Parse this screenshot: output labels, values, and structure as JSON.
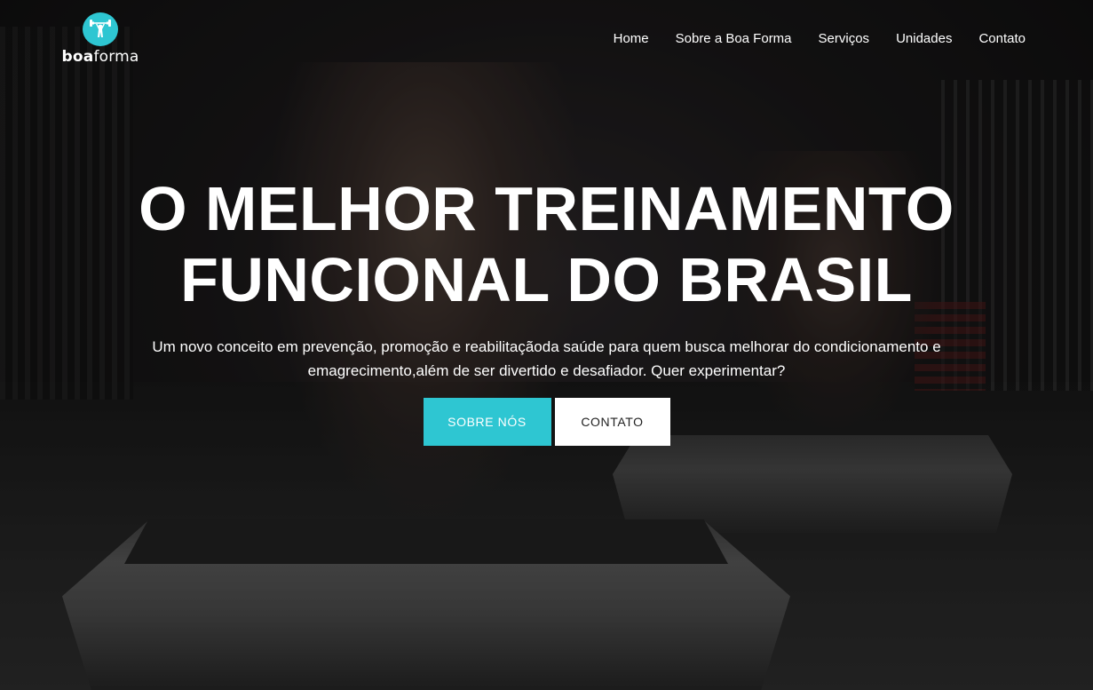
{
  "brand": {
    "name_bold": "boa",
    "name_light": "forma",
    "accent_color": "#2ec6d2",
    "icon": "dumbbell-person-icon"
  },
  "nav": {
    "items": [
      {
        "label": "Home"
      },
      {
        "label": "Sobre a Boa Forma"
      },
      {
        "label": "Serviços"
      },
      {
        "label": "Unidades"
      },
      {
        "label": "Contato"
      }
    ]
  },
  "hero": {
    "title_line1": "O MELHOR TREINAMENTO",
    "title_line2": "FUNCIONAL DO BRASIL",
    "subtitle_line1": "Um novo conceito em prevenção, promoção e reabilitaçãoda saúde para quem busca melhorar do condicionamento e",
    "subtitle_line2": "emagrecimento,além de ser divertido e desafiador. Quer experimentar?",
    "primary_button": "SOBRE NÓS",
    "secondary_button": "CONTATO"
  }
}
